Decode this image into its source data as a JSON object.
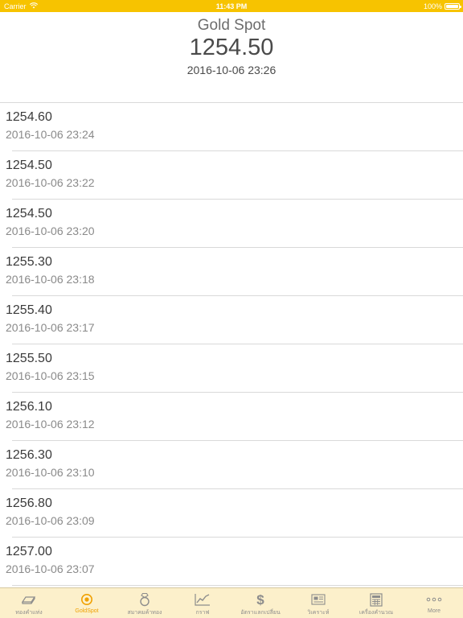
{
  "status_bar": {
    "carrier": "Carrier",
    "time": "11:43 PM",
    "battery": "100%"
  },
  "header": {
    "title": "Gold Spot",
    "price": "1254.50",
    "timestamp": "2016-10-06 23:26"
  },
  "rows": [
    {
      "price": "1254.60",
      "time": "2016-10-06 23:24"
    },
    {
      "price": "1254.50",
      "time": "2016-10-06 23:22"
    },
    {
      "price": "1254.50",
      "time": "2016-10-06 23:20"
    },
    {
      "price": "1255.30",
      "time": "2016-10-06 23:18"
    },
    {
      "price": "1255.40",
      "time": "2016-10-06 23:17"
    },
    {
      "price": "1255.50",
      "time": "2016-10-06 23:15"
    },
    {
      "price": "1256.10",
      "time": "2016-10-06 23:12"
    },
    {
      "price": "1256.30",
      "time": "2016-10-06 23:10"
    },
    {
      "price": "1256.80",
      "time": "2016-10-06 23:09"
    },
    {
      "price": "1257.00",
      "time": "2016-10-06 23:07"
    }
  ],
  "tabs": [
    {
      "label": "ทองคำแท่ง",
      "icon": "gold-bar-icon"
    },
    {
      "label": "GoldSpot",
      "icon": "target-icon",
      "active": true
    },
    {
      "label": "สมาคมค้าทอง",
      "icon": "ring-icon"
    },
    {
      "label": "กราฟ",
      "icon": "chart-icon"
    },
    {
      "label": "อัตราแลกเปลี่ยน",
      "icon": "dollar-icon"
    },
    {
      "label": "วิเคราะห์",
      "icon": "news-icon"
    },
    {
      "label": "เครื่องคำนวณ",
      "icon": "calculator-icon"
    },
    {
      "label": "More",
      "icon": "more-icon"
    }
  ],
  "colors": {
    "accent": "#f7c300",
    "tab_active": "#f0a000",
    "tab_bar_bg": "#fcf0cb"
  }
}
